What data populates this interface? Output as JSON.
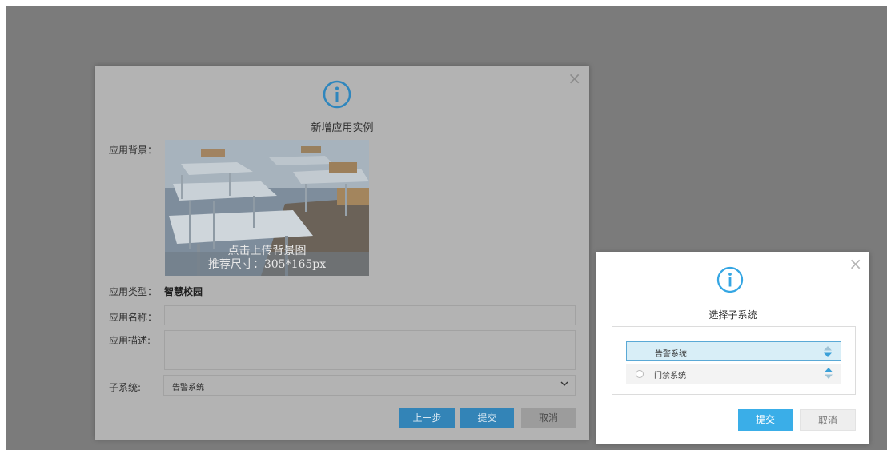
{
  "main_dialog": {
    "title": "新增应用实例",
    "close_symbol": "×",
    "icon": "info-circle-icon",
    "background_label": "应用背景：",
    "upload_text_1": "点击上传背景图",
    "upload_text_2": "推荐尺寸：305*165px",
    "type_label": "应用类型：",
    "type_value": "智慧校园",
    "name_label": "应用名称：",
    "name_value": "",
    "desc_label": "应用描述:",
    "desc_value": "",
    "subsystem_label": "子系统:",
    "subsystem_value": "告警系统",
    "prev_button": "上一步",
    "submit_button": "提交",
    "cancel_button": "取消"
  },
  "popup": {
    "title": "选择子系统",
    "close_symbol": "×",
    "icon": "info-circle-icon",
    "items": [
      {
        "label": "告警系统",
        "selected": true
      },
      {
        "label": "门禁系统",
        "selected": false
      }
    ],
    "submit_button": "提交",
    "cancel_button": "取消"
  },
  "colors": {
    "overlay": "#7b7b7b",
    "primary": "#3aaee8",
    "primary_dimmed": "#3384b7",
    "selected_row": "#d8eef7"
  }
}
